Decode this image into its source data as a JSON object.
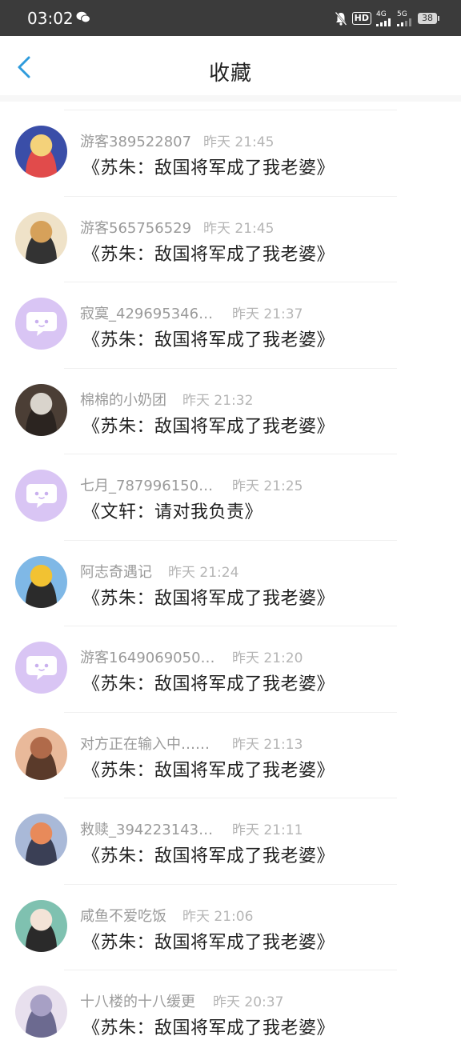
{
  "status_bar": {
    "time": "03:02",
    "battery": "38",
    "net_4g": "4G",
    "net_5g": "5G",
    "hd": "HD"
  },
  "header": {
    "title": "收藏"
  },
  "items": [
    {
      "name": "游客389522807",
      "time": "昨天  21:45",
      "message": "《苏朱：敌国将军成了我老婆》",
      "avatar": "photo",
      "colors": [
        "#3a4ea8",
        "#f4d27a",
        "#e14b4b"
      ]
    },
    {
      "name": "游客565756529",
      "time": "昨天  21:45",
      "message": "《苏朱：敌国将军成了我老婆》",
      "avatar": "photo",
      "colors": [
        "#efe2c8",
        "#d6a15a",
        "#333333"
      ]
    },
    {
      "name": "寂寞_429695346…",
      "time": "昨天  21:37",
      "message": "《苏朱：敌国将军成了我老婆》",
      "avatar": "default"
    },
    {
      "name": "棉棉的小奶团",
      "time": "昨天  21:32",
      "message": "《苏朱：敌国将军成了我老婆》",
      "avatar": "photo",
      "colors": [
        "#4b3e35",
        "#d9d4cc",
        "#2b2420"
      ]
    },
    {
      "name": "七月_787996150…",
      "time": "昨天  21:25",
      "message": "《文轩：请对我负责》",
      "avatar": "default"
    },
    {
      "name": "阿志奇遇记",
      "time": "昨天  21:24",
      "message": "《苏朱：敌国将军成了我老婆》",
      "avatar": "photo",
      "colors": [
        "#7fb8e6",
        "#f2c232",
        "#2b2b2b"
      ]
    },
    {
      "name": "游客1649069050…",
      "time": "昨天  21:20",
      "message": "《苏朱：敌国将军成了我老婆》",
      "avatar": "default"
    },
    {
      "name": "对方正在输入中……",
      "time": "昨天  21:13",
      "message": "《苏朱：敌国将军成了我老婆》",
      "avatar": "photo",
      "colors": [
        "#e9b99a",
        "#b06a4a",
        "#5a3a2a"
      ]
    },
    {
      "name": "救赎_394223143…",
      "time": "昨天  21:11",
      "message": "《苏朱：敌国将军成了我老婆》",
      "avatar": "photo",
      "colors": [
        "#a9b9d8",
        "#e88a5a",
        "#3a3f55"
      ]
    },
    {
      "name": "咸鱼不爱吃饭",
      "time": "昨天  21:06",
      "message": "《苏朱：敌国将军成了我老婆》",
      "avatar": "photo",
      "colors": [
        "#7fc1b0",
        "#f3e3d7",
        "#2a2a2a"
      ]
    },
    {
      "name": "十八楼的十八缓更",
      "time": "昨天  20:37",
      "message": "《苏朱：敌国将军成了我老婆》",
      "avatar": "photo",
      "colors": [
        "#e8e0ee",
        "#a7a0c5",
        "#6c6a90"
      ]
    }
  ]
}
